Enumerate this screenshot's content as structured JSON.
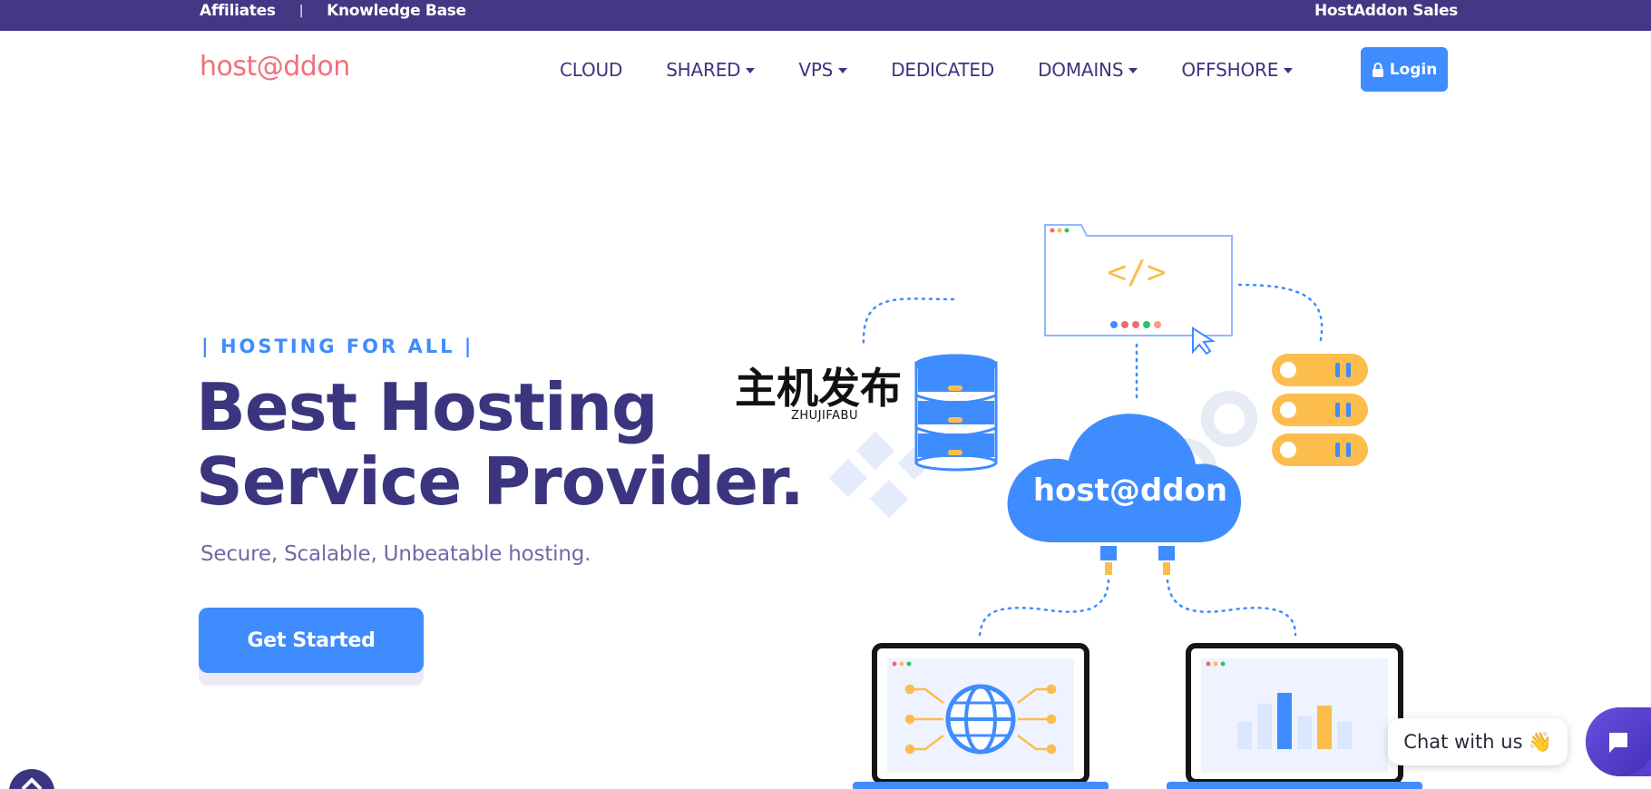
{
  "topbar": {
    "links": [
      "Affiliates",
      "Knowledge Base"
    ],
    "separator": "|",
    "sales": "HostAddon Sales"
  },
  "header": {
    "logo": "host@ddon",
    "nav": [
      {
        "label": "CLOUD",
        "dropdown": false
      },
      {
        "label": "SHARED",
        "dropdown": true
      },
      {
        "label": "VPS",
        "dropdown": true
      },
      {
        "label": "DEDICATED",
        "dropdown": false
      },
      {
        "label": "DOMAINS",
        "dropdown": true
      },
      {
        "label": "OFFSHORE",
        "dropdown": true
      }
    ],
    "login": "Login"
  },
  "hero": {
    "tagline": "| HOSTING FOR ALL |",
    "headline_line1": "Best Hosting",
    "headline_line2": "Service Provider.",
    "subtitle": "Secure, Scalable, Unbeatable hosting.",
    "cta": "Get Started"
  },
  "illustration": {
    "cloud_label": "host@ddon",
    "code_symbol": "</>"
  },
  "watermark": {
    "chinese": "主机发布",
    "latin": "ZHUJIFABU"
  },
  "chat": {
    "bubble": "Chat with us",
    "emoji": "👋"
  },
  "colors": {
    "topbar": "#443885",
    "primary": "#3f8cff",
    "heading": "#3b3580",
    "logo": "#f0707c"
  }
}
